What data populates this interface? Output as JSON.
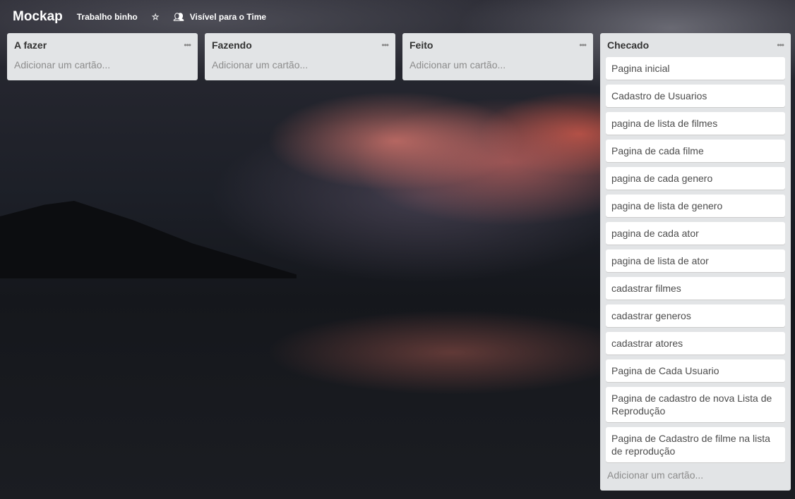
{
  "header": {
    "board_title": "Mockap",
    "team": "Trabalho binho",
    "visibility": "Visível para o Time",
    "star_icon": "star-icon",
    "visibility_icon": "team-icon"
  },
  "add_card_label": "Adicionar um cartão...",
  "lists": [
    {
      "title": "A fazer",
      "cards": []
    },
    {
      "title": "Fazendo",
      "cards": []
    },
    {
      "title": "Feito",
      "cards": []
    },
    {
      "title": "Checado",
      "cards": [
        "Pagina inicial",
        "Cadastro de Usuarios",
        "pagina de lista de filmes",
        "Pagina de cada filme",
        "pagina de cada genero",
        "pagina de lista de genero",
        "pagina de cada ator",
        "pagina de lista de ator",
        "cadastrar filmes",
        "cadastrar generos",
        "cadastrar atores",
        "Pagina de Cada Usuario",
        "Pagina de cadastro de nova Lista de Reprodução",
        "Pagina de Cadastro de filme na lista de reprodução"
      ]
    }
  ]
}
